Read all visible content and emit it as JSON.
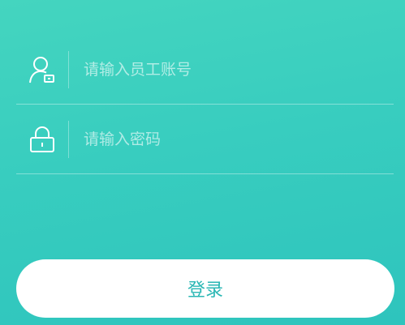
{
  "form": {
    "account": {
      "icon": "user-id-icon",
      "placeholder": "请输入员工账号",
      "value": ""
    },
    "password": {
      "icon": "lock-icon",
      "placeholder": "请输入密码",
      "value": ""
    }
  },
  "login_button": {
    "label": "登录"
  },
  "colors": {
    "background_top": "#44d5bf",
    "background_bottom": "#2ec4bd",
    "button_bg": "#ffffff",
    "button_text": "#2ab7b4"
  }
}
